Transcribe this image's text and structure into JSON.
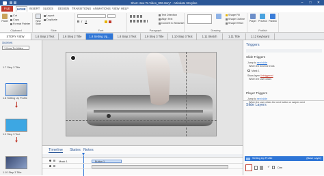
{
  "window": {
    "title": "Short-How-To-Video_002.story* - Articulate Storyline",
    "controls": [
      "–",
      "□",
      "✕"
    ]
  },
  "ribbon_tabs": [
    "FILE",
    "HOME",
    "INSERT",
    "SLIDES",
    "DESIGN",
    "TRANSITIONS",
    "ANIMATIONS",
    "VIEW",
    "HELP"
  ],
  "ribbon": {
    "clipboard": {
      "paste": "Paste",
      "cut": "Cut",
      "copy": "Copy",
      "format_painter": "Format Painter",
      "label": "Clipboard"
    },
    "slide": {
      "new_slide": "New Slide",
      "layout": "Layout",
      "duplicate": "Duplicate",
      "label": "Slide"
    },
    "font": {
      "label": "Font"
    },
    "paragraph": {
      "label": "Paragraph"
    },
    "drawing": {
      "label": "Drawing",
      "shape_fill": "Shape Fill",
      "shape_outline": "Shape Outline",
      "shape_effect": "Shape Effect"
    },
    "text_direction": "Text Direction",
    "align_text": "Align Text",
    "convert": "Convert to SmartArt",
    "publish": {
      "player": "Player",
      "preview": "Preview",
      "publish": "Publish",
      "label": "Publish"
    }
  },
  "slide_tabs": [
    {
      "label": "STORY VIEW"
    },
    {
      "label": "1.6 Step 2 Text"
    },
    {
      "label": "1.6 Step 2 Title"
    },
    {
      "label": "1.8 Setting Up..."
    },
    {
      "label": "1.8 Step 3 Text"
    },
    {
      "label": "1.9 Step 3 Title"
    },
    {
      "label": "1.10 Step 3 Text"
    },
    {
      "label": "1.11 Sketch"
    },
    {
      "label": "1.11 Title"
    },
    {
      "label": "1.12 Keyboard"
    }
  ],
  "scenes": {
    "header": "Scenes",
    "selected": "1 How To Video",
    "slides": [
      {
        "caption": "1.7 Step 3 Title"
      },
      {
        "caption": "1.8 Setting Up Profile"
      },
      {
        "caption": "1.9 Step 3 Text"
      },
      {
        "caption": "1.10 Step 3 Title"
      }
    ]
  },
  "timeline": {
    "tabs": [
      "Timeline",
      "States",
      "Notes"
    ],
    "rows": [
      {
        "name": "Button 1"
      },
      {
        "name": "Mask 1"
      }
    ]
  },
  "triggers": {
    "header": "Triggers",
    "slide_triggers": "Slide Triggers",
    "trigger1_line1": "Jump to ",
    "trigger1_link": "next slide",
    "trigger1_line2": "When the timeline ends",
    "layer_name": "Mask 1",
    "show_layer": "Show layer ",
    "show_layer_link": "Untriggered",
    "when_clicks": "When the user clicks",
    "player_triggers": "Player Triggers",
    "player_jump": "Jump to ",
    "player_link": "next slide",
    "player_when": "When the user clicks the next button or swipes next"
  },
  "slide_layers": {
    "header": "Slide Layers",
    "base_layer": "Setting Up Profile",
    "base_tag": "(Base Layer)",
    "row_label": "Dim"
  }
}
